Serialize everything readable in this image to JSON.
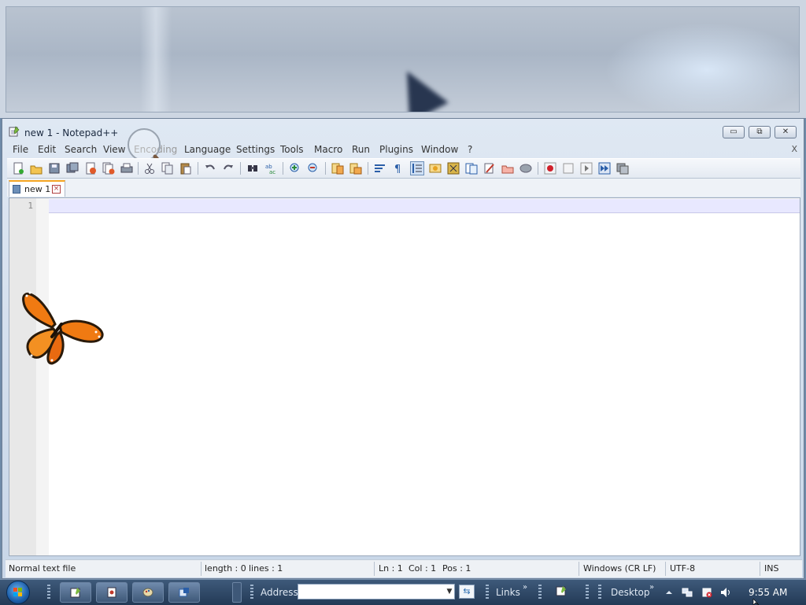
{
  "window": {
    "title": "new 1 - Notepad++",
    "minimize": "▭",
    "restore": "⧉",
    "close": "✕"
  },
  "menu": {
    "items": [
      "File",
      "Edit",
      "Search",
      "View",
      "Encoding",
      "Language",
      "Settings",
      "Tools",
      "Macro",
      "Run",
      "Plugins",
      "Window",
      "?"
    ],
    "close_label": "X"
  },
  "toolbar": {
    "icons": [
      "new-file-icon",
      "open-file-icon",
      "save-icon",
      "save-all-icon",
      "close-icon",
      "close-all-icon",
      "print-icon",
      "cut-icon",
      "copy-icon",
      "paste-icon",
      "undo-icon",
      "redo-icon",
      "find-icon",
      "replace-icon",
      "zoom-in-icon",
      "zoom-out-icon",
      "sync-v-icon",
      "sync-h-icon",
      "word-wrap-icon",
      "show-all-chars-icon",
      "indent-guide-icon",
      "udl-icon",
      "doc-map-icon",
      "function-list-icon",
      "folder-workspace-icon",
      "monitoring-icon",
      "record-macro-icon",
      "stop-macro-icon",
      "play-macro-icon",
      "run-multiple-macro-icon",
      "save-macro-icon"
    ]
  },
  "tabs": [
    {
      "label": "new 1",
      "close": "×"
    }
  ],
  "editor": {
    "line_numbers": [
      "1"
    ],
    "content": ""
  },
  "status": {
    "type": "Normal text file",
    "length": "length : 0",
    "lines": "lines : 1",
    "ln": "Ln : 1",
    "col": "Col : 1",
    "pos": "Pos : 1",
    "eol": "Windows (CR LF)",
    "encoding": "UTF-8",
    "mode": "INS"
  },
  "taskbar": {
    "address_label": "Address",
    "address_value": "",
    "links_label": "Links",
    "desktop_label": "Desktop",
    "chevron": "»",
    "clock": "9:55 AM",
    "go_symbol": "⇆",
    "drop_symbol": "▼"
  }
}
